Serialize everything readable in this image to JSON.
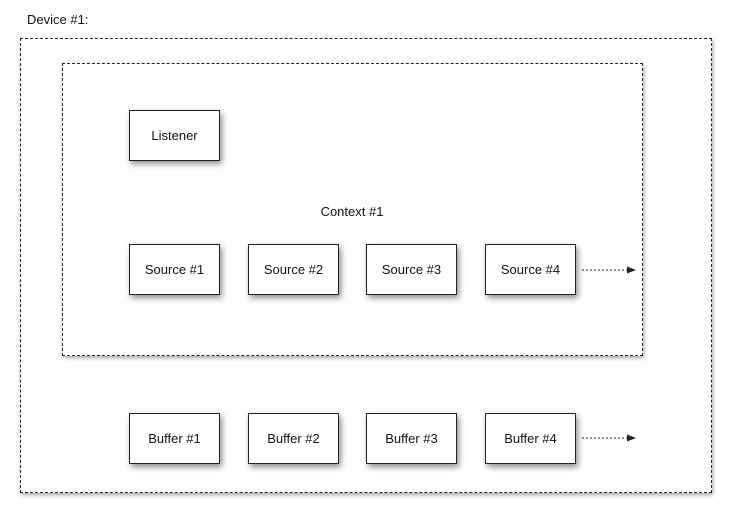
{
  "device": {
    "label": "Device #1:"
  },
  "context": {
    "label": "Context #1"
  },
  "listener": {
    "label": "Listener"
  },
  "sources": [
    "Source #1",
    "Source #2",
    "Source #3",
    "Source #4"
  ],
  "buffers": [
    "Buffer #1",
    "Buffer #2",
    "Buffer #3",
    "Buffer #4"
  ]
}
